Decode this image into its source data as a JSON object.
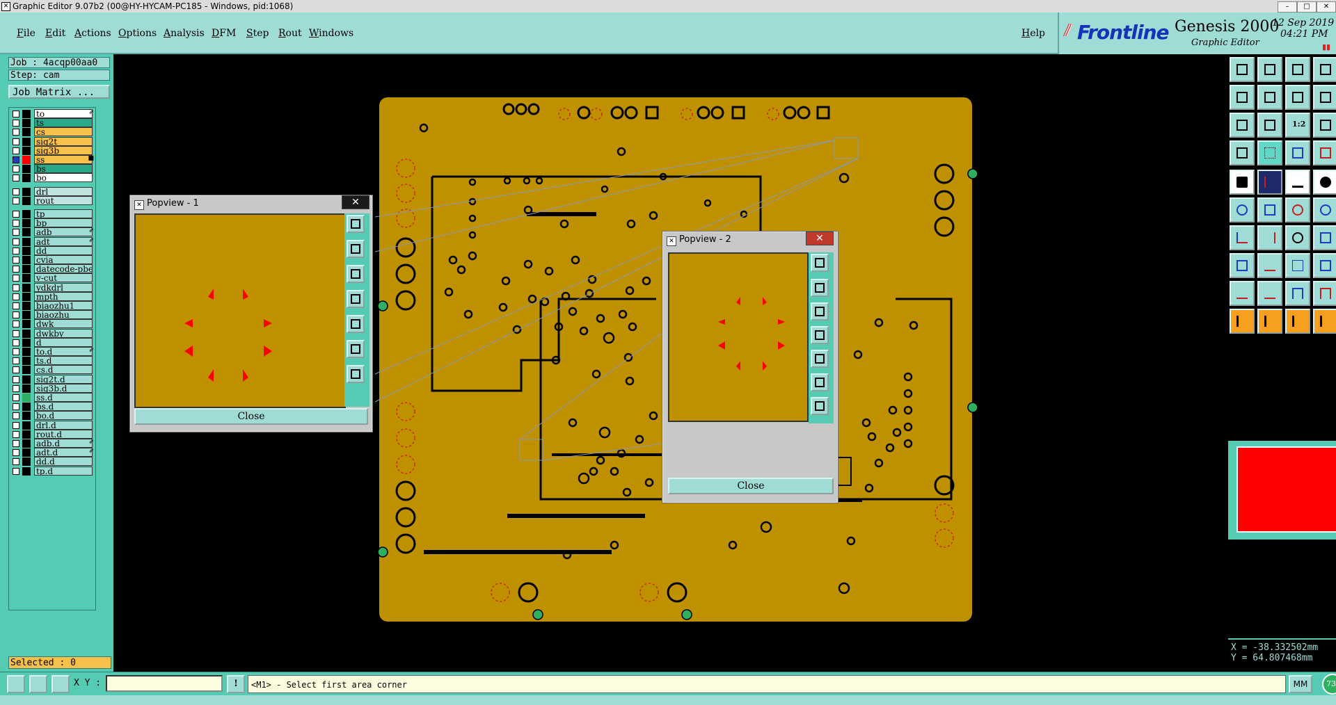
{
  "window": {
    "title": "Graphic Editor 9.07b2 (00@HY-HYCAM-PC185 - Windows, pid:1068)"
  },
  "menu": [
    "File",
    "Edit",
    "Actions",
    "Options",
    "Analysis",
    "DFM",
    "Step",
    "Rout",
    "Windows"
  ],
  "help_label": "Help",
  "brand": {
    "logo_text": "Frontline",
    "product": "Genesis 2000",
    "subtitle": "Graphic Editor",
    "date": "12 Sep 2019",
    "time": "04:21 PM",
    "pause_glyph": "▮▮"
  },
  "job": {
    "job_line": "Job : 4acqp00aa0",
    "step_line": "Step: cam",
    "matrix_button": "Job Matrix ..."
  },
  "layers": [
    {
      "name": "to",
      "color": "#ffffff",
      "mark": "⇙"
    },
    {
      "name": "ts",
      "color": "#2aa98a",
      "mark": ""
    },
    {
      "name": "cs",
      "color": "#f7c04a",
      "mark": ""
    },
    {
      "name": "sig2t",
      "color": "#f7c04a",
      "mark": ""
    },
    {
      "name": "sig3b",
      "color": "#f7c04a",
      "mark": ""
    },
    {
      "name": "ss",
      "color": "#f7c04a",
      "mark": "■",
      "active": true
    },
    {
      "name": "bs",
      "color": "#2aa98a",
      "mark": ""
    },
    {
      "name": "bo",
      "color": "#ffffff",
      "mark": ""
    },
    {
      "name": "drl",
      "color": "#bfe3e0",
      "mark": "",
      "gap": true
    },
    {
      "name": "rout",
      "color": "#bfe3e0",
      "mark": ""
    },
    {
      "name": "tp",
      "color": "#9fdcd6",
      "mark": "",
      "gap": true
    },
    {
      "name": "bp",
      "color": "#9fdcd6",
      "mark": ""
    },
    {
      "name": "adb",
      "color": "#9fdcd6",
      "mark": "⇙"
    },
    {
      "name": "adt",
      "color": "#9fdcd6",
      "mark": "⇙"
    },
    {
      "name": "dd",
      "color": "#9fdcd6",
      "mark": ""
    },
    {
      "name": "cvia",
      "color": "#9fdcd6",
      "mark": ""
    },
    {
      "name": "datecode-pbe",
      "color": "#9fdcd6",
      "mark": ""
    },
    {
      "name": "v-cut",
      "color": "#9fdcd6",
      "mark": ""
    },
    {
      "name": "ydkdrl",
      "color": "#9fdcd6",
      "mark": ""
    },
    {
      "name": "mpth",
      "color": "#9fdcd6",
      "mark": ""
    },
    {
      "name": "biaozhu1",
      "color": "#9fdcd6",
      "mark": ""
    },
    {
      "name": "biaozhu",
      "color": "#9fdcd6",
      "mark": ""
    },
    {
      "name": "dwk",
      "color": "#9fdcd6",
      "mark": ""
    },
    {
      "name": "dwkby",
      "color": "#9fdcd6",
      "mark": ""
    },
    {
      "name": "d",
      "color": "#9fdcd6",
      "mark": ""
    },
    {
      "name": "to.d",
      "color": "#9fdcd6",
      "mark": "⇙"
    },
    {
      "name": "ts.d",
      "color": "#9fdcd6",
      "mark": ""
    },
    {
      "name": "cs.d",
      "color": "#9fdcd6",
      "mark": ""
    },
    {
      "name": "sig2t.d",
      "color": "#9fdcd6",
      "mark": ""
    },
    {
      "name": "sig3b.d",
      "color": "#9fdcd6",
      "mark": ""
    },
    {
      "name": "ss.d",
      "color": "#9fdcd6",
      "mark": "",
      "swatch": "#2fb060"
    },
    {
      "name": "bs.d",
      "color": "#9fdcd6",
      "mark": ""
    },
    {
      "name": "bo.d",
      "color": "#9fdcd6",
      "mark": ""
    },
    {
      "name": "drl.d",
      "color": "#9fdcd6",
      "mark": ""
    },
    {
      "name": "rout.d",
      "color": "#9fdcd6",
      "mark": ""
    },
    {
      "name": "adb.d",
      "color": "#9fdcd6",
      "mark": "⇙"
    },
    {
      "name": "adt.d",
      "color": "#9fdcd6",
      "mark": "⇙"
    },
    {
      "name": "dd.d",
      "color": "#9fdcd6",
      "mark": ""
    },
    {
      "name": "tp.d",
      "color": "#9fdcd6",
      "mark": ""
    }
  ],
  "selected": "Selected : 0",
  "popview1": {
    "title": "Popview - 1",
    "close": "Close"
  },
  "popview2": {
    "title": "Popview - 2",
    "close": "Close"
  },
  "coords": {
    "x": "X = -38.332502mm",
    "y": "Y = 64.807468mm"
  },
  "status": {
    "xy_label": "X Y :",
    "xy_value": "",
    "message": "<M1> - Select first area corner",
    "unit": "MM",
    "indicator": "73"
  },
  "colors": {
    "board": "#bf9000",
    "panel": "#55cbb4",
    "menubar": "#9fdcd6",
    "highlight": "#ff0000",
    "pad_green": "#2fb060"
  }
}
